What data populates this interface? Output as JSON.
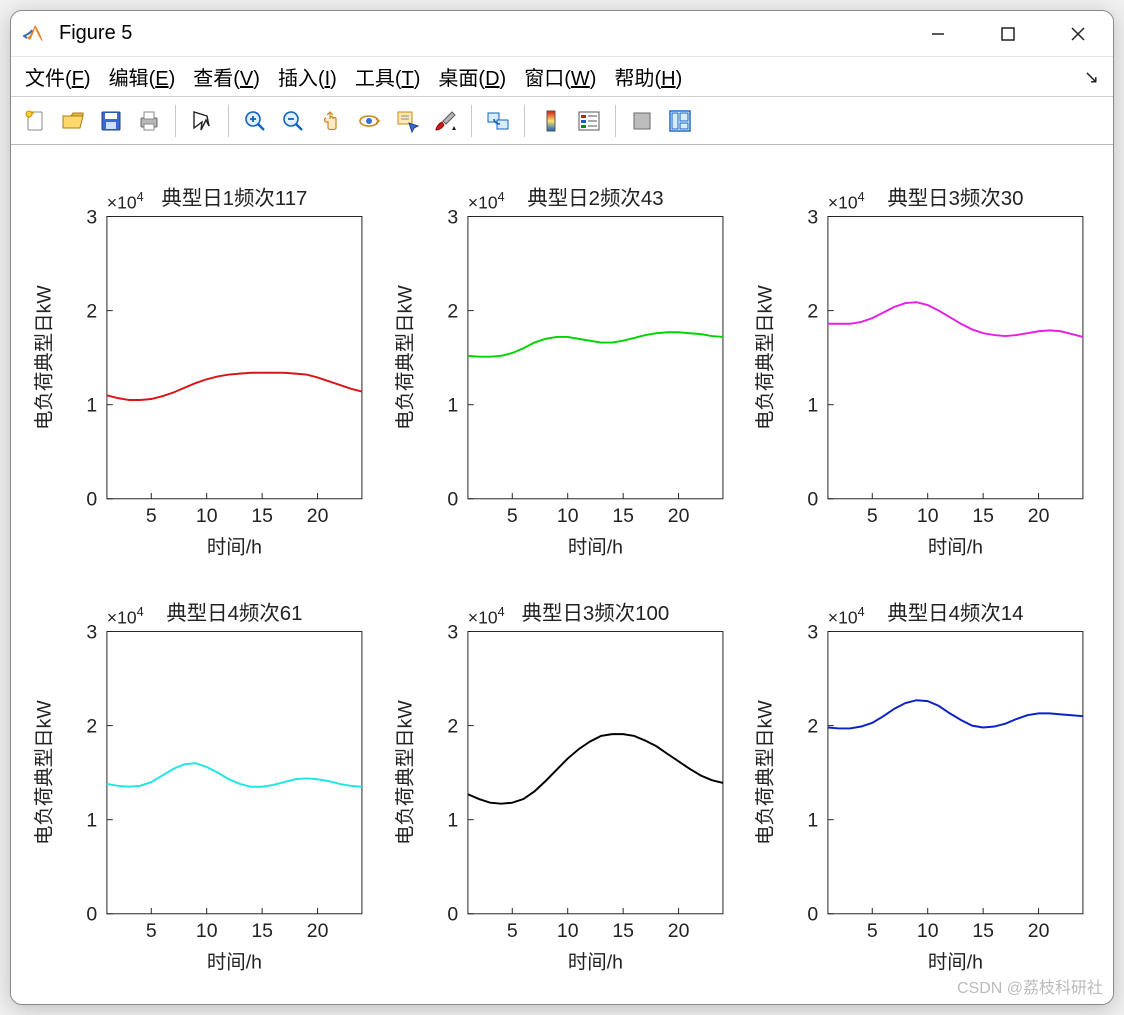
{
  "window": {
    "title": "Figure 5"
  },
  "menu": {
    "file": {
      "label": "文件",
      "mnemonic": "F"
    },
    "edit": {
      "label": "编辑",
      "mnemonic": "E"
    },
    "view": {
      "label": "查看",
      "mnemonic": "V"
    },
    "insert": {
      "label": "插入",
      "mnemonic": "I"
    },
    "tools": {
      "label": "工具",
      "mnemonic": "T"
    },
    "desktop": {
      "label": "桌面",
      "mnemonic": "D"
    },
    "window": {
      "label": "窗口",
      "mnemonic": "W"
    },
    "help": {
      "label": "帮助",
      "mnemonic": "H"
    }
  },
  "toolbar": {
    "new": "新建",
    "open": "打开",
    "save": "保存",
    "print": "打印",
    "pointer": "编辑绘图",
    "zoomin": "放大",
    "zoomout": "缩小",
    "pan": "平移",
    "rotate": "旋转",
    "datatip": "数据提示",
    "brush": "刷选",
    "link": "链接",
    "colorbar": "颜色栏",
    "legend": "图例",
    "hide": "隐藏绘图工具",
    "show": "显示绘图工具"
  },
  "axes_common": {
    "xlabel": "时间/h",
    "ylabel": "电负荷典型日kW",
    "multiplier": "×10",
    "multiplier_exp": "4",
    "xlim": [
      1,
      24
    ],
    "ylim": [
      0,
      3
    ],
    "xticks": [
      5,
      10,
      15,
      20
    ],
    "yticks": [
      0,
      1,
      2,
      3
    ]
  },
  "watermark": "CSDN @荔枝科研社",
  "chart_data": [
    {
      "type": "line",
      "title": "典型日1频次117",
      "color": "#d91414",
      "x": [
        1,
        2,
        3,
        4,
        5,
        6,
        7,
        8,
        9,
        10,
        11,
        12,
        13,
        14,
        15,
        16,
        17,
        18,
        19,
        20,
        21,
        22,
        23,
        24
      ],
      "y": [
        1.1,
        1.07,
        1.05,
        1.05,
        1.06,
        1.09,
        1.13,
        1.18,
        1.23,
        1.27,
        1.3,
        1.32,
        1.33,
        1.34,
        1.34,
        1.34,
        1.34,
        1.33,
        1.32,
        1.29,
        1.25,
        1.21,
        1.17,
        1.14
      ],
      "xlabel": "时间/h",
      "ylabel": "电负荷典型日kW",
      "xlim": [
        1,
        24
      ],
      "ylim": [
        0,
        3
      ]
    },
    {
      "type": "line",
      "title": "典型日2频次43",
      "color": "#00d400",
      "x": [
        1,
        2,
        3,
        4,
        5,
        6,
        7,
        8,
        9,
        10,
        11,
        12,
        13,
        14,
        15,
        16,
        17,
        18,
        19,
        20,
        21,
        22,
        23,
        24
      ],
      "y": [
        1.52,
        1.51,
        1.51,
        1.52,
        1.55,
        1.6,
        1.66,
        1.7,
        1.72,
        1.72,
        1.7,
        1.68,
        1.66,
        1.66,
        1.68,
        1.71,
        1.74,
        1.76,
        1.77,
        1.77,
        1.76,
        1.75,
        1.73,
        1.72
      ],
      "xlabel": "时间/h",
      "ylabel": "电负荷典型日kW",
      "xlim": [
        1,
        24
      ],
      "ylim": [
        0,
        3
      ]
    },
    {
      "type": "line",
      "title": "典型日3频次30",
      "color": "#e61fe6",
      "x": [
        1,
        2,
        3,
        4,
        5,
        6,
        7,
        8,
        9,
        10,
        11,
        12,
        13,
        14,
        15,
        16,
        17,
        18,
        19,
        20,
        21,
        22,
        23,
        24
      ],
      "y": [
        1.86,
        1.86,
        1.86,
        1.88,
        1.92,
        1.98,
        2.04,
        2.08,
        2.09,
        2.06,
        2.0,
        1.93,
        1.86,
        1.8,
        1.76,
        1.74,
        1.73,
        1.74,
        1.76,
        1.78,
        1.79,
        1.78,
        1.75,
        1.72
      ],
      "xlabel": "时间/h",
      "ylabel": "电负荷典型日kW",
      "xlim": [
        1,
        24
      ],
      "ylim": [
        0,
        3
      ]
    },
    {
      "type": "line",
      "title": "典型日4频次61",
      "color": "#1ee6e6",
      "x": [
        1,
        2,
        3,
        4,
        5,
        6,
        7,
        8,
        9,
        10,
        11,
        12,
        13,
        14,
        15,
        16,
        17,
        18,
        19,
        20,
        21,
        22,
        23,
        24
      ],
      "y": [
        1.38,
        1.36,
        1.35,
        1.36,
        1.4,
        1.47,
        1.54,
        1.59,
        1.6,
        1.56,
        1.5,
        1.43,
        1.38,
        1.35,
        1.35,
        1.37,
        1.4,
        1.43,
        1.44,
        1.43,
        1.41,
        1.38,
        1.36,
        1.35
      ],
      "xlabel": "时间/h",
      "ylabel": "电负荷典型日kW",
      "xlim": [
        1,
        24
      ],
      "ylim": [
        0,
        3
      ]
    },
    {
      "type": "line",
      "title": "典型日3频次100",
      "color": "#000000",
      "x": [
        1,
        2,
        3,
        4,
        5,
        6,
        7,
        8,
        9,
        10,
        11,
        12,
        13,
        14,
        15,
        16,
        17,
        18,
        19,
        20,
        21,
        22,
        23,
        24
      ],
      "y": [
        1.27,
        1.22,
        1.18,
        1.17,
        1.18,
        1.22,
        1.3,
        1.41,
        1.53,
        1.65,
        1.75,
        1.83,
        1.89,
        1.91,
        1.91,
        1.89,
        1.84,
        1.78,
        1.7,
        1.62,
        1.54,
        1.47,
        1.42,
        1.39
      ],
      "xlabel": "时间/h",
      "ylabel": "电负荷典型日kW",
      "xlim": [
        1,
        24
      ],
      "ylim": [
        0,
        3
      ]
    },
    {
      "type": "line",
      "title": "典型日4频次14",
      "color": "#0a22c8",
      "x": [
        1,
        2,
        3,
        4,
        5,
        6,
        7,
        8,
        9,
        10,
        11,
        12,
        13,
        14,
        15,
        16,
        17,
        18,
        19,
        20,
        21,
        22,
        23,
        24
      ],
      "y": [
        1.98,
        1.97,
        1.97,
        1.99,
        2.03,
        2.1,
        2.18,
        2.24,
        2.27,
        2.26,
        2.21,
        2.13,
        2.06,
        2.0,
        1.98,
        1.99,
        2.02,
        2.07,
        2.11,
        2.13,
        2.13,
        2.12,
        2.11,
        2.1
      ],
      "xlabel": "时间/h",
      "ylabel": "电负荷典型日kW",
      "xlim": [
        1,
        24
      ],
      "ylim": [
        0,
        3
      ]
    }
  ]
}
